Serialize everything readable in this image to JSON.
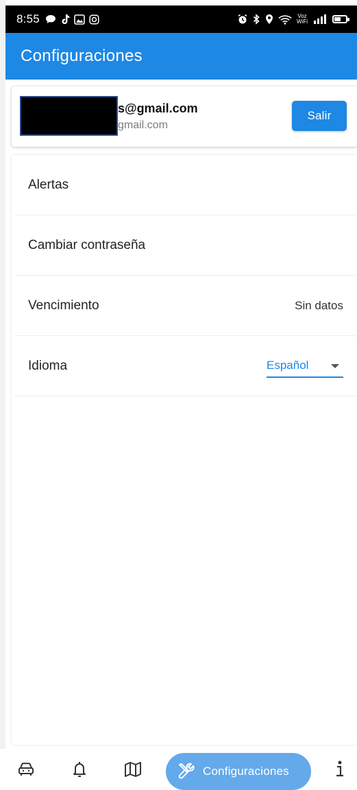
{
  "status_bar": {
    "time": "8:55",
    "voz_wifi_label": "Voz\nWiFi",
    "left_icons": [
      "chat-bubble-icon",
      "tiktok-icon",
      "image-icon",
      "instagram-icon"
    ],
    "right_icons": [
      "alarm-icon",
      "bluetooth-icon",
      "location-icon",
      "wifi-icon",
      "signal-icon",
      "battery-icon"
    ]
  },
  "app_bar": {
    "title": "Configuraciones",
    "color": "#1e88e5"
  },
  "account": {
    "email": "s@gmail.com",
    "secondary": "gmail.com",
    "logout_label": "Salir"
  },
  "settings": {
    "alerts_label": "Alertas",
    "change_password_label": "Cambiar contraseña",
    "expiration_label": "Vencimiento",
    "expiration_value": "Sin datos",
    "language_label": "Idioma",
    "language_value": "Español"
  },
  "bottom_nav": {
    "items": [
      {
        "icon": "car-icon"
      },
      {
        "icon": "bell-icon"
      },
      {
        "icon": "map-icon"
      },
      {
        "icon": "tools-icon",
        "label": "Configuraciones",
        "active": true
      },
      {
        "icon": "info-icon"
      }
    ],
    "active_color": "#64a9ea"
  }
}
